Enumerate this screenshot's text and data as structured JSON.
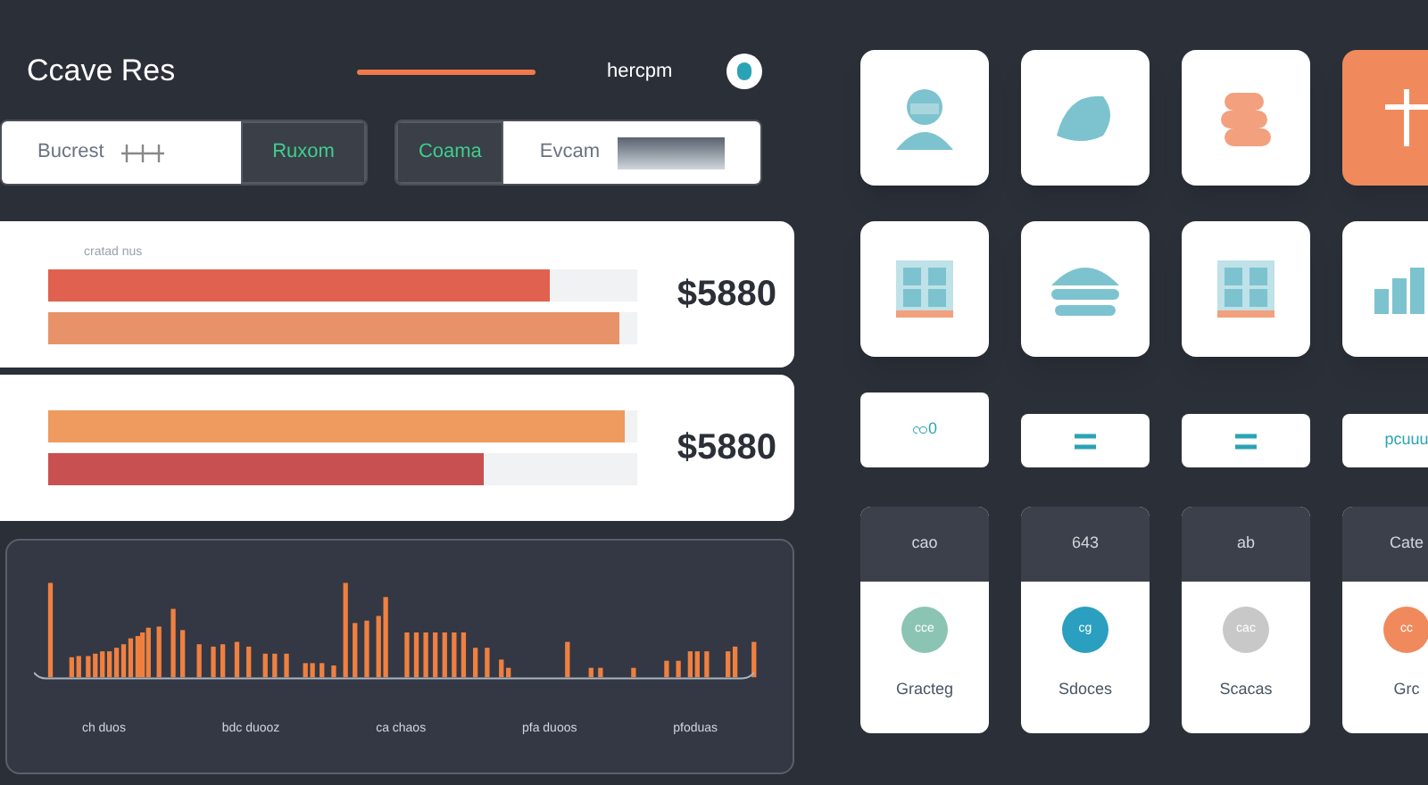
{
  "header": {
    "title": "Ccave Res",
    "user": "hercpm"
  },
  "search_bars": [
    {
      "placeholder": "Bucrest",
      "button": "Ruxom",
      "kind": "search"
    },
    {
      "button": "Coama",
      "placeholder": "Evcam",
      "kind": "filter"
    }
  ],
  "summary_cards": [
    {
      "caption": "cratad nus",
      "amount": "$5880",
      "bars": [
        {
          "level": 0.85,
          "color": "#e0614f"
        },
        {
          "level": 0.97,
          "color": "#e8926a"
        }
      ]
    },
    {
      "amount": "$5880",
      "bars": [
        {
          "level": 0.98,
          "color": "#ef9a5e"
        },
        {
          "level": 0.74,
          "color": "#c95050"
        }
      ]
    }
  ],
  "activity_chart": {
    "labels": [
      "ch duos",
      "bdc duooz",
      "ca chaos",
      "pfa duoos",
      "pfoduas"
    ]
  },
  "tiles": [
    {
      "kind": "person",
      "highlighted": false
    },
    {
      "kind": "cap",
      "highlighted": false
    },
    {
      "kind": "bread",
      "highlighted": false
    },
    {
      "kind": "cross",
      "highlighted": true
    },
    {
      "kind": "grid",
      "highlighted": false
    },
    {
      "kind": "stack",
      "highlighted": false
    },
    {
      "kind": "grid",
      "highlighted": false
    },
    {
      "kind": "chart",
      "highlighted": false
    }
  ],
  "small_buttons": [
    {
      "label": "ၸ0",
      "kind": "text"
    },
    {
      "kind": "equals"
    },
    {
      "kind": "equals"
    },
    {
      "label": "pcuuu",
      "kind": "text"
    }
  ],
  "status_cards": [
    {
      "header": "cao",
      "badge": "cce",
      "label": "Gracteg",
      "color": "#8cc4b4"
    },
    {
      "header": "643",
      "badge": "cg",
      "label": "Sdoces",
      "color": "#2a9fbf"
    },
    {
      "header": "ab",
      "badge": "cac",
      "label": "Scacas",
      "color": "#c8c8c8"
    },
    {
      "header": "Cate",
      "badge": "cc",
      "label": "Grc",
      "color": "#f08a5d"
    }
  ]
}
